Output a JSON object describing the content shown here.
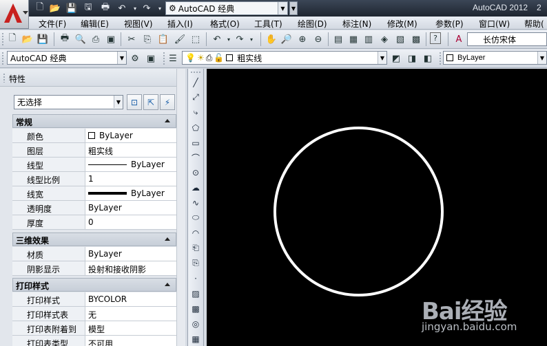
{
  "title_bar": {
    "app_title": "AutoCAD 2012",
    "app_title_extra": "2",
    "workspace": "AutoCAD 经典",
    "quick_access": [
      "new-icon",
      "open-icon",
      "save-icon",
      "saveas-icon",
      "print-icon",
      "undo-icon",
      "redo-icon",
      "workspace-gear-icon"
    ]
  },
  "menu": {
    "items": [
      "文件(F)",
      "编辑(E)",
      "视图(V)",
      "插入(I)",
      "格式(O)",
      "工具(T)",
      "绘图(D)",
      "标注(N)",
      "修改(M)",
      "参数(P)",
      "窗口(W)",
      "帮助("
    ]
  },
  "standard_toolbar": {
    "font_combo": "长仿宋体"
  },
  "workspace_toolbar": {
    "workspace_combo": "AutoCAD 经典",
    "layer_combo": "粗实线",
    "color_combo": "ByLayer"
  },
  "properties": {
    "title": "特性",
    "selection": "无选择",
    "sections": [
      {
        "name": "常规",
        "rows": [
          {
            "label": "颜色",
            "value": "ByLayer"
          },
          {
            "label": "图层",
            "value": "粗实线"
          },
          {
            "label": "线型",
            "value": "ByLayer"
          },
          {
            "label": "线型比例",
            "value": "1"
          },
          {
            "label": "线宽",
            "value": "ByLayer"
          },
          {
            "label": "透明度",
            "value": "ByLayer"
          },
          {
            "label": "厚度",
            "value": "0"
          }
        ]
      },
      {
        "name": "三维效果",
        "rows": [
          {
            "label": "材质",
            "value": "ByLayer"
          },
          {
            "label": "阴影显示",
            "value": "投射和接收阴影"
          }
        ]
      },
      {
        "name": "打印样式",
        "rows": [
          {
            "label": "打印样式",
            "value": "BYCOLOR"
          },
          {
            "label": "打印样式表",
            "value": "无"
          },
          {
            "label": "打印表附着到",
            "value": "模型"
          },
          {
            "label": "打印表类型",
            "value": "不可用"
          }
        ]
      }
    ]
  },
  "watermark": {
    "brand": "Bai经验",
    "url": "jingyan.baidu.com"
  },
  "colors": {
    "canvas": "#000000",
    "circle": "#ffffff",
    "title_bar": "#2a3340",
    "logo": "#c8201e"
  }
}
